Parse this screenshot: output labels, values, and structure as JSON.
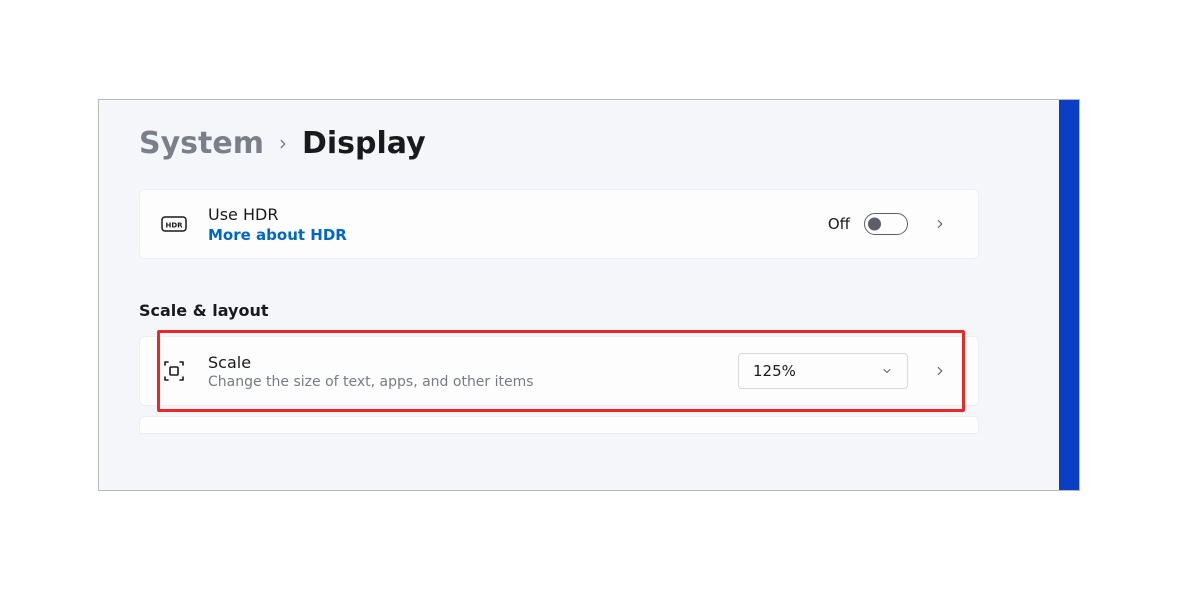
{
  "breadcrumb": {
    "parent": "System",
    "current": "Display"
  },
  "hdr": {
    "title": "Use HDR",
    "link": "More about HDR",
    "toggle_state_label": "Off",
    "toggle_on": false
  },
  "section": {
    "title": "Scale & layout"
  },
  "scale": {
    "title": "Scale",
    "subtitle": "Change the size of text, apps, and other items",
    "value": "125%"
  },
  "icons": {
    "hdr": "hdr-icon",
    "scale": "scale-icon",
    "chevron_right": "chevron-right-icon",
    "chevron_down": "chevron-down-icon"
  }
}
